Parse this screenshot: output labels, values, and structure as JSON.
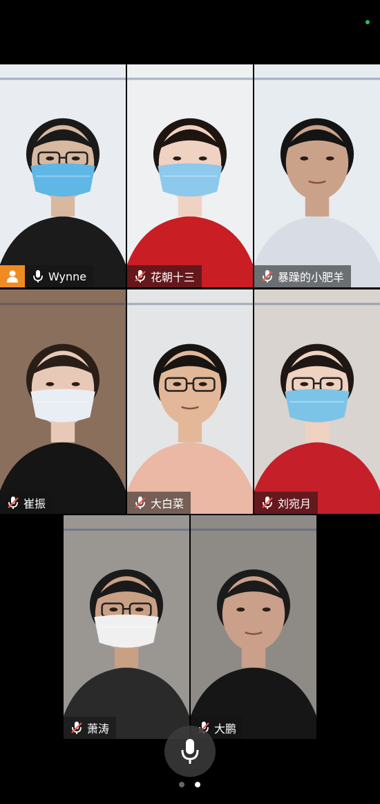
{
  "participants": [
    {
      "name": "Wynne",
      "mic": "on",
      "host": true,
      "active": false,
      "bg": "#e9edf2",
      "clothing": "#1b1b1b",
      "skin": "#d9b8a0",
      "hair": "#1a1a1a",
      "mask": "#5fb7e6",
      "glasses": true
    },
    {
      "name": "花朝十三",
      "mic": "muted",
      "host": false,
      "active": false,
      "bg": "#eef0f2",
      "clothing": "#c81e24",
      "skin": "#f0d2c2",
      "hair": "#1e1410",
      "mask": "#8cc9ec",
      "glasses": false
    },
    {
      "name": "暴躁的小肥羊",
      "mic": "muted",
      "host": false,
      "active": false,
      "bg": "#e7ecf1",
      "clothing": "#d8dde5",
      "skin": "#caa28a",
      "hair": "#141414",
      "mask": "",
      "glasses": false
    },
    {
      "name": "崔振",
      "mic": "muted",
      "host": false,
      "active": true,
      "bg": "#8a6f5c",
      "clothing": "#151515",
      "skin": "#e8c9b8",
      "hair": "#2a1e18",
      "mask": "#e9eef4",
      "glasses": false
    },
    {
      "name": "大白菜",
      "mic": "muted",
      "host": false,
      "active": false,
      "bg": "#e4e5e7",
      "clothing": "#eab8a4",
      "skin": "#e2b899",
      "hair": "#171412",
      "mask": "",
      "glasses": true
    },
    {
      "name": "刘宛月",
      "mic": "muted",
      "host": false,
      "active": false,
      "bg": "#d9d4cf",
      "clothing": "#c51f2a",
      "skin": "#efd2c0",
      "hair": "#1f1713",
      "mask": "#7cc4e7",
      "glasses": true
    },
    {
      "name": "萧涛",
      "mic": "muted",
      "host": false,
      "active": false,
      "bg": "#9a9793",
      "clothing": "#2a2a2a",
      "skin": "#caa085",
      "hair": "#1a1a1a",
      "mask": "#f0f0f0",
      "glasses": true
    },
    {
      "name": "大鹏",
      "mic": "muted",
      "host": false,
      "active": false,
      "bg": "#8e8b86",
      "clothing": "#161616",
      "skin": "#caa08a",
      "hair": "#1b1b1b",
      "mask": "",
      "glasses": false
    }
  ],
  "page_indicator": {
    "count": 2,
    "current": 2
  },
  "colors": {
    "host_badge": "#f08a24",
    "active_border": "#34b96b",
    "muted_mic": "#e8584a",
    "status_dot": "#22c55e"
  }
}
